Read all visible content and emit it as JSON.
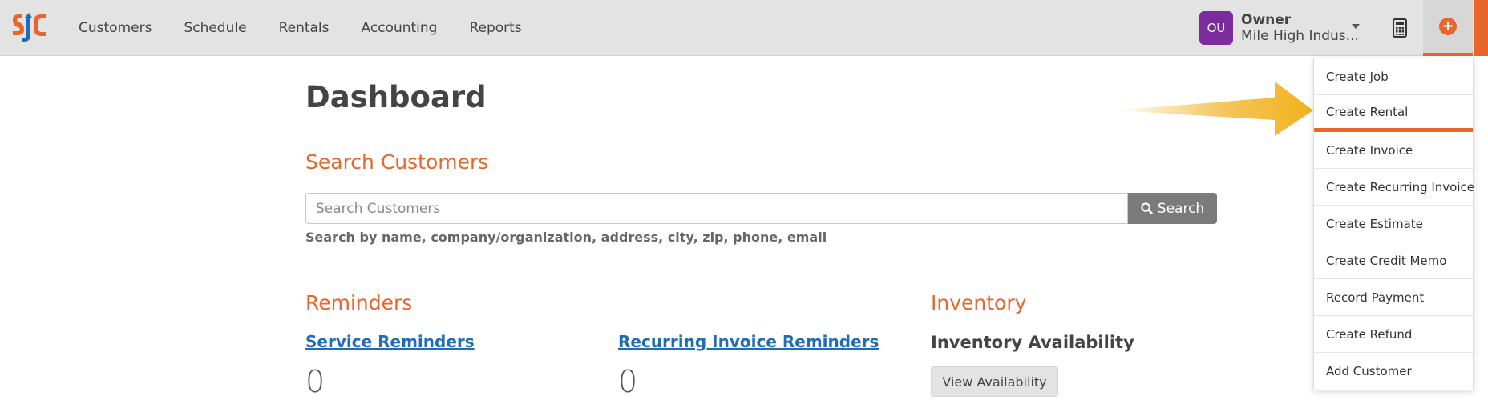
{
  "nav": {
    "items": [
      "Customers",
      "Schedule",
      "Rentals",
      "Accounting",
      "Reports"
    ]
  },
  "user": {
    "initials": "OU",
    "role": "Owner",
    "org": "Mile High Indus..."
  },
  "page": {
    "title": "Dashboard"
  },
  "search": {
    "heading": "Search Customers",
    "placeholder": "Search Customers",
    "button_label": "Search",
    "hint": "Search by name, company/organization, address, city, zip, phone, email"
  },
  "reminders": {
    "heading": "Reminders",
    "service_label": "Service Reminders",
    "service_count": "0",
    "recurring_label": "Recurring Invoice Reminders",
    "recurring_count": "0"
  },
  "inventory": {
    "heading": "Inventory",
    "subheading": "Inventory Availability",
    "button_label": "View Availability"
  },
  "create_menu": {
    "items": [
      "Create Job",
      "Create Rental",
      "Create Invoice",
      "Create Recurring Invoice",
      "Create Estimate",
      "Create Credit Memo",
      "Record Payment",
      "Create Refund",
      "Add Customer"
    ],
    "highlighted": "Create Rental"
  },
  "colors": {
    "accent": "#e8662c",
    "link": "#1f6db4",
    "avatar": "#7b2b9c",
    "topbar": "#e3e3e3",
    "arrow": "#f2b21a"
  },
  "icons": {
    "logo": "sjc-logo",
    "calculator": "calculator-icon",
    "plus": "plus-circle-icon",
    "search": "search-icon",
    "caret": "caret-down-icon"
  }
}
